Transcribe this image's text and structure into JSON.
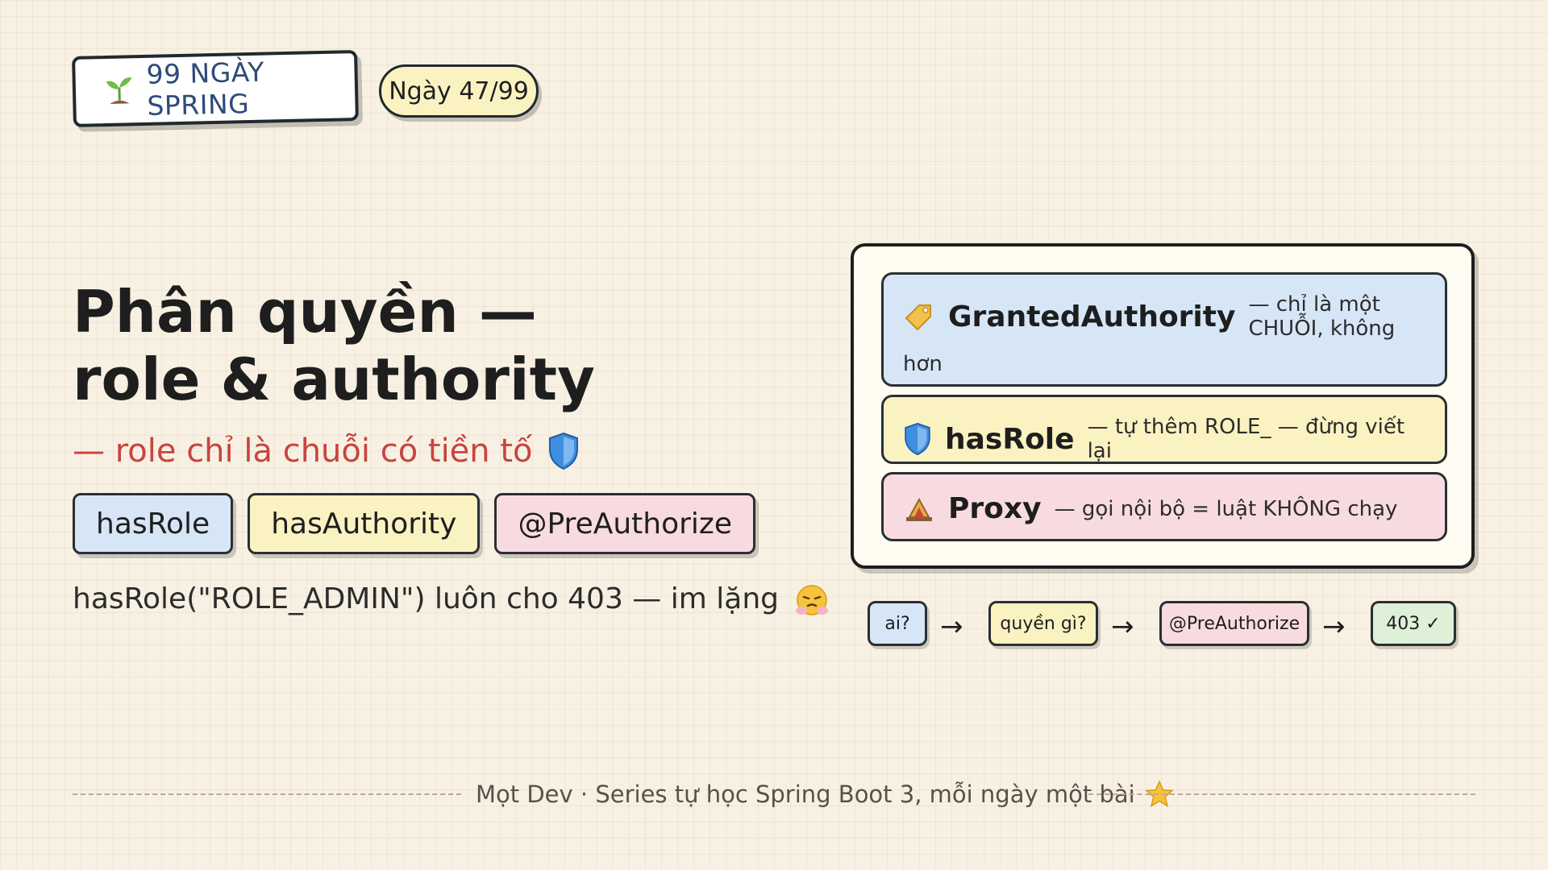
{
  "brand": {
    "label": "99 NGÀY SPRING",
    "icon": "sprout-icon"
  },
  "day": {
    "label": "Ngày 47/99"
  },
  "title": {
    "line1": "Phân quyền —",
    "line2": "role & authority"
  },
  "subtitle": {
    "text": "— role chỉ là chuỗi có tiền tố",
    "icon": "shield-icon"
  },
  "tags": [
    "hasRole",
    "hasAuthority",
    "@PreAuthorize"
  ],
  "note": {
    "text": "hasRole(\"ROLE_ADMIN\") luôn cho 403 — im lặng",
    "icon": "steaming-face-icon"
  },
  "card": {
    "rows": [
      {
        "keyword": "GrantedAuthority",
        "desc": "— chỉ là một CHUỖI, không",
        "wrap": "hơn",
        "icon": "tag-icon"
      },
      {
        "keyword": "hasRole",
        "desc": "— tự thêm ROLE_ — đừng viết lại",
        "icon": "shield-icon"
      },
      {
        "keyword": "Proxy",
        "desc": "— gọi nội bộ = luật KHÔNG chạy",
        "icon": "trap-icon"
      }
    ]
  },
  "flow": {
    "steps": [
      "ai?",
      "quyền gì?",
      "@PreAuthorize",
      "403 ✓"
    ],
    "arrow": "→"
  },
  "footer": {
    "text": "Mọt Dev · Series tự học Spring Boot 3, mỗi ngày một bài",
    "icon": "star-icon"
  },
  "colors": {
    "background": "#f8f1e3",
    "accent_red": "#c8443f",
    "blue": "#d6e6f7",
    "yellow": "#fbf2c2",
    "pink": "#f8dbe1",
    "green": "#dff0d8",
    "brand_text": "#2f4a7a"
  }
}
